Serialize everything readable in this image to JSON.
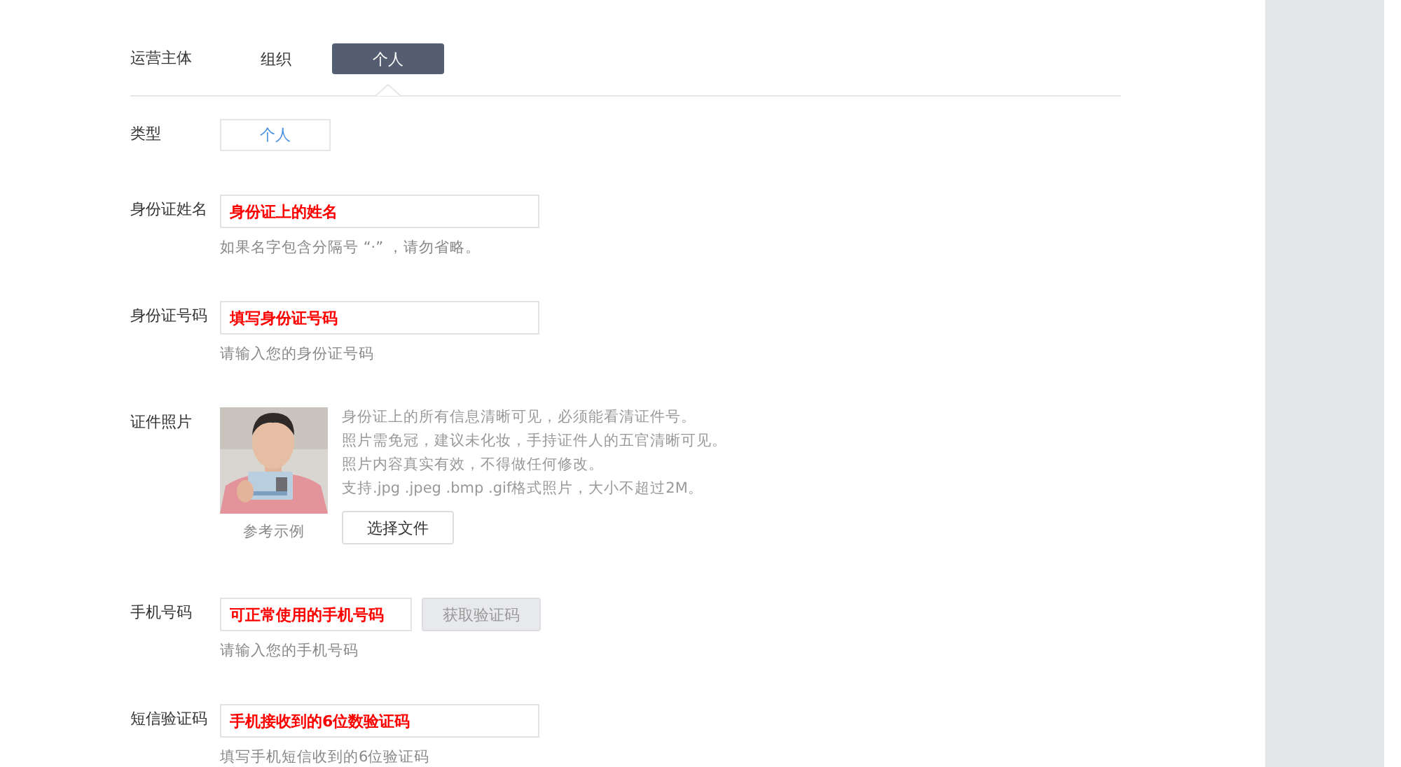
{
  "operator": {
    "label": "运营主体",
    "tabs": [
      {
        "label": "组织",
        "selected": false
      },
      {
        "label": "个人",
        "selected": true
      }
    ]
  },
  "fields": [
    {
      "kind": "type",
      "label": "类型",
      "value": "个人"
    },
    {
      "kind": "input",
      "label": "身份证姓名",
      "value": "身份证上的姓名",
      "hint": "如果名字包含分隔号 “·” ，请勿省略。"
    },
    {
      "kind": "input",
      "label": "身份证号码",
      "value": "填写身份证号码",
      "hint": "请输入您的身份证号码"
    },
    {
      "label": "证件照片",
      "caption": "参考示例",
      "notes": [
        "身份证上的所有信息清晰可见，必须能看清证件号。",
        "照片需免冠，建议未化妆，手持证件人的五官清晰可见。",
        "照片内容真实有效，不得做任何修改。",
        "支持.jpg .jpeg .bmp .gif格式照片，大小不超过2M。"
      ],
      "button": "选择文件"
    },
    {
      "kind": "input",
      "label": "手机号码",
      "value": "可正常使用的手机号码",
      "hint": "请输入您的手机号码",
      "button": {
        "label": "获取验证码",
        "disabled": true
      }
    },
    {
      "kind": "input",
      "label": "短信验证码",
      "value": "手机接收到的6位数验证码",
      "hint": "填写手机短信收到的6位验证码"
    }
  ]
}
